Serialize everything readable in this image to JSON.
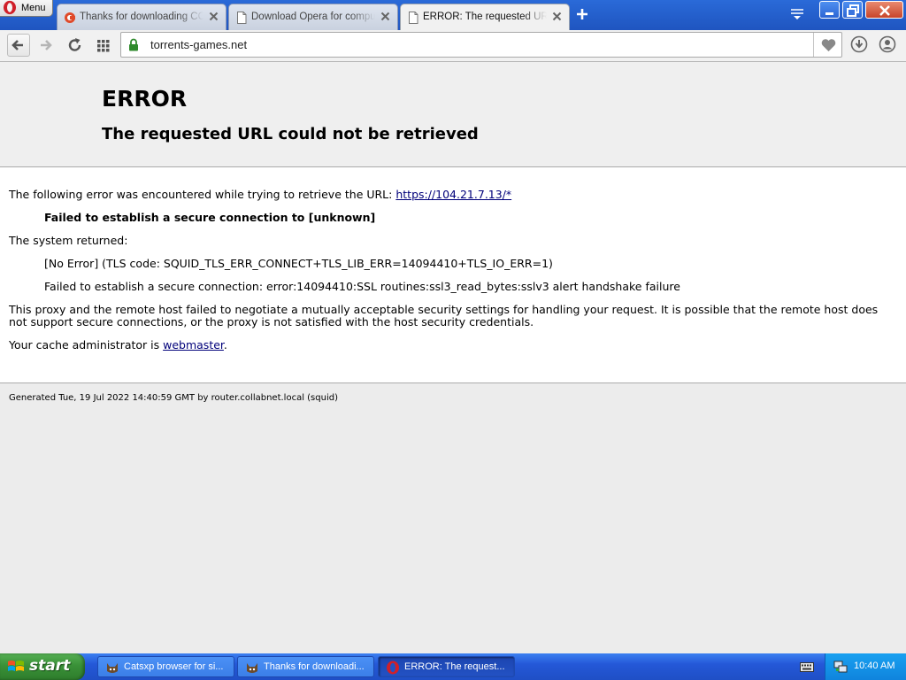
{
  "browser": {
    "menu_label": "Menu",
    "tabs": [
      {
        "title": "Thanks for downloading CCleaner",
        "active": false,
        "icon": "ccleaner-icon"
      },
      {
        "title": "Download Opera for computers",
        "active": false,
        "icon": "page-icon"
      },
      {
        "title": "ERROR: The requested URL could not be retrieved",
        "active": true,
        "icon": "page-icon"
      }
    ],
    "address": {
      "url": "torrents-games.net",
      "secure": true
    }
  },
  "error_page": {
    "heading": "ERROR",
    "subheading": "The requested URL could not be retrieved",
    "intro_text": "The following error was encountered while trying to retrieve the URL: ",
    "url_link": "https://104.21.7.13/*",
    "error_message": "Failed to establish a secure connection to [unknown]",
    "system_returned_label": "The system returned:",
    "tls_code": "[No Error] (TLS code: SQUID_TLS_ERR_CONNECT+TLS_LIB_ERR=14094410+TLS_IO_ERR=1)",
    "ssl_detail": "Failed to establish a secure connection: error:14094410:SSL routines:ssl3_read_bytes:sslv3 alert handshake failure",
    "explanation_line1": "This proxy and the remote host failed to negotiate a mutually acceptable security settings for handling your request. It is possible that the remote host does",
    "explanation_line2": "not support secure connections, or the proxy is not satisfied with the host security credentials.",
    "admin_prefix": "Your cache administrator is ",
    "admin_link": "webmaster",
    "admin_suffix": ".",
    "footer": "Generated Tue, 19 Jul 2022 14:40:59 GMT by router.collabnet.local (squid)"
  },
  "taskbar": {
    "start_label": "start",
    "tasks": [
      {
        "title": "Catsxp browser for si...",
        "active": false
      },
      {
        "title": "Thanks for downloadi...",
        "active": false
      },
      {
        "title": "ERROR: The request...",
        "active": true
      }
    ],
    "clock": "10:40 AM"
  },
  "colors": {
    "tabstrip": "#1f55c0",
    "link": "#00007a",
    "taskbar": "#2458d8",
    "start_button": "#3a9138"
  }
}
